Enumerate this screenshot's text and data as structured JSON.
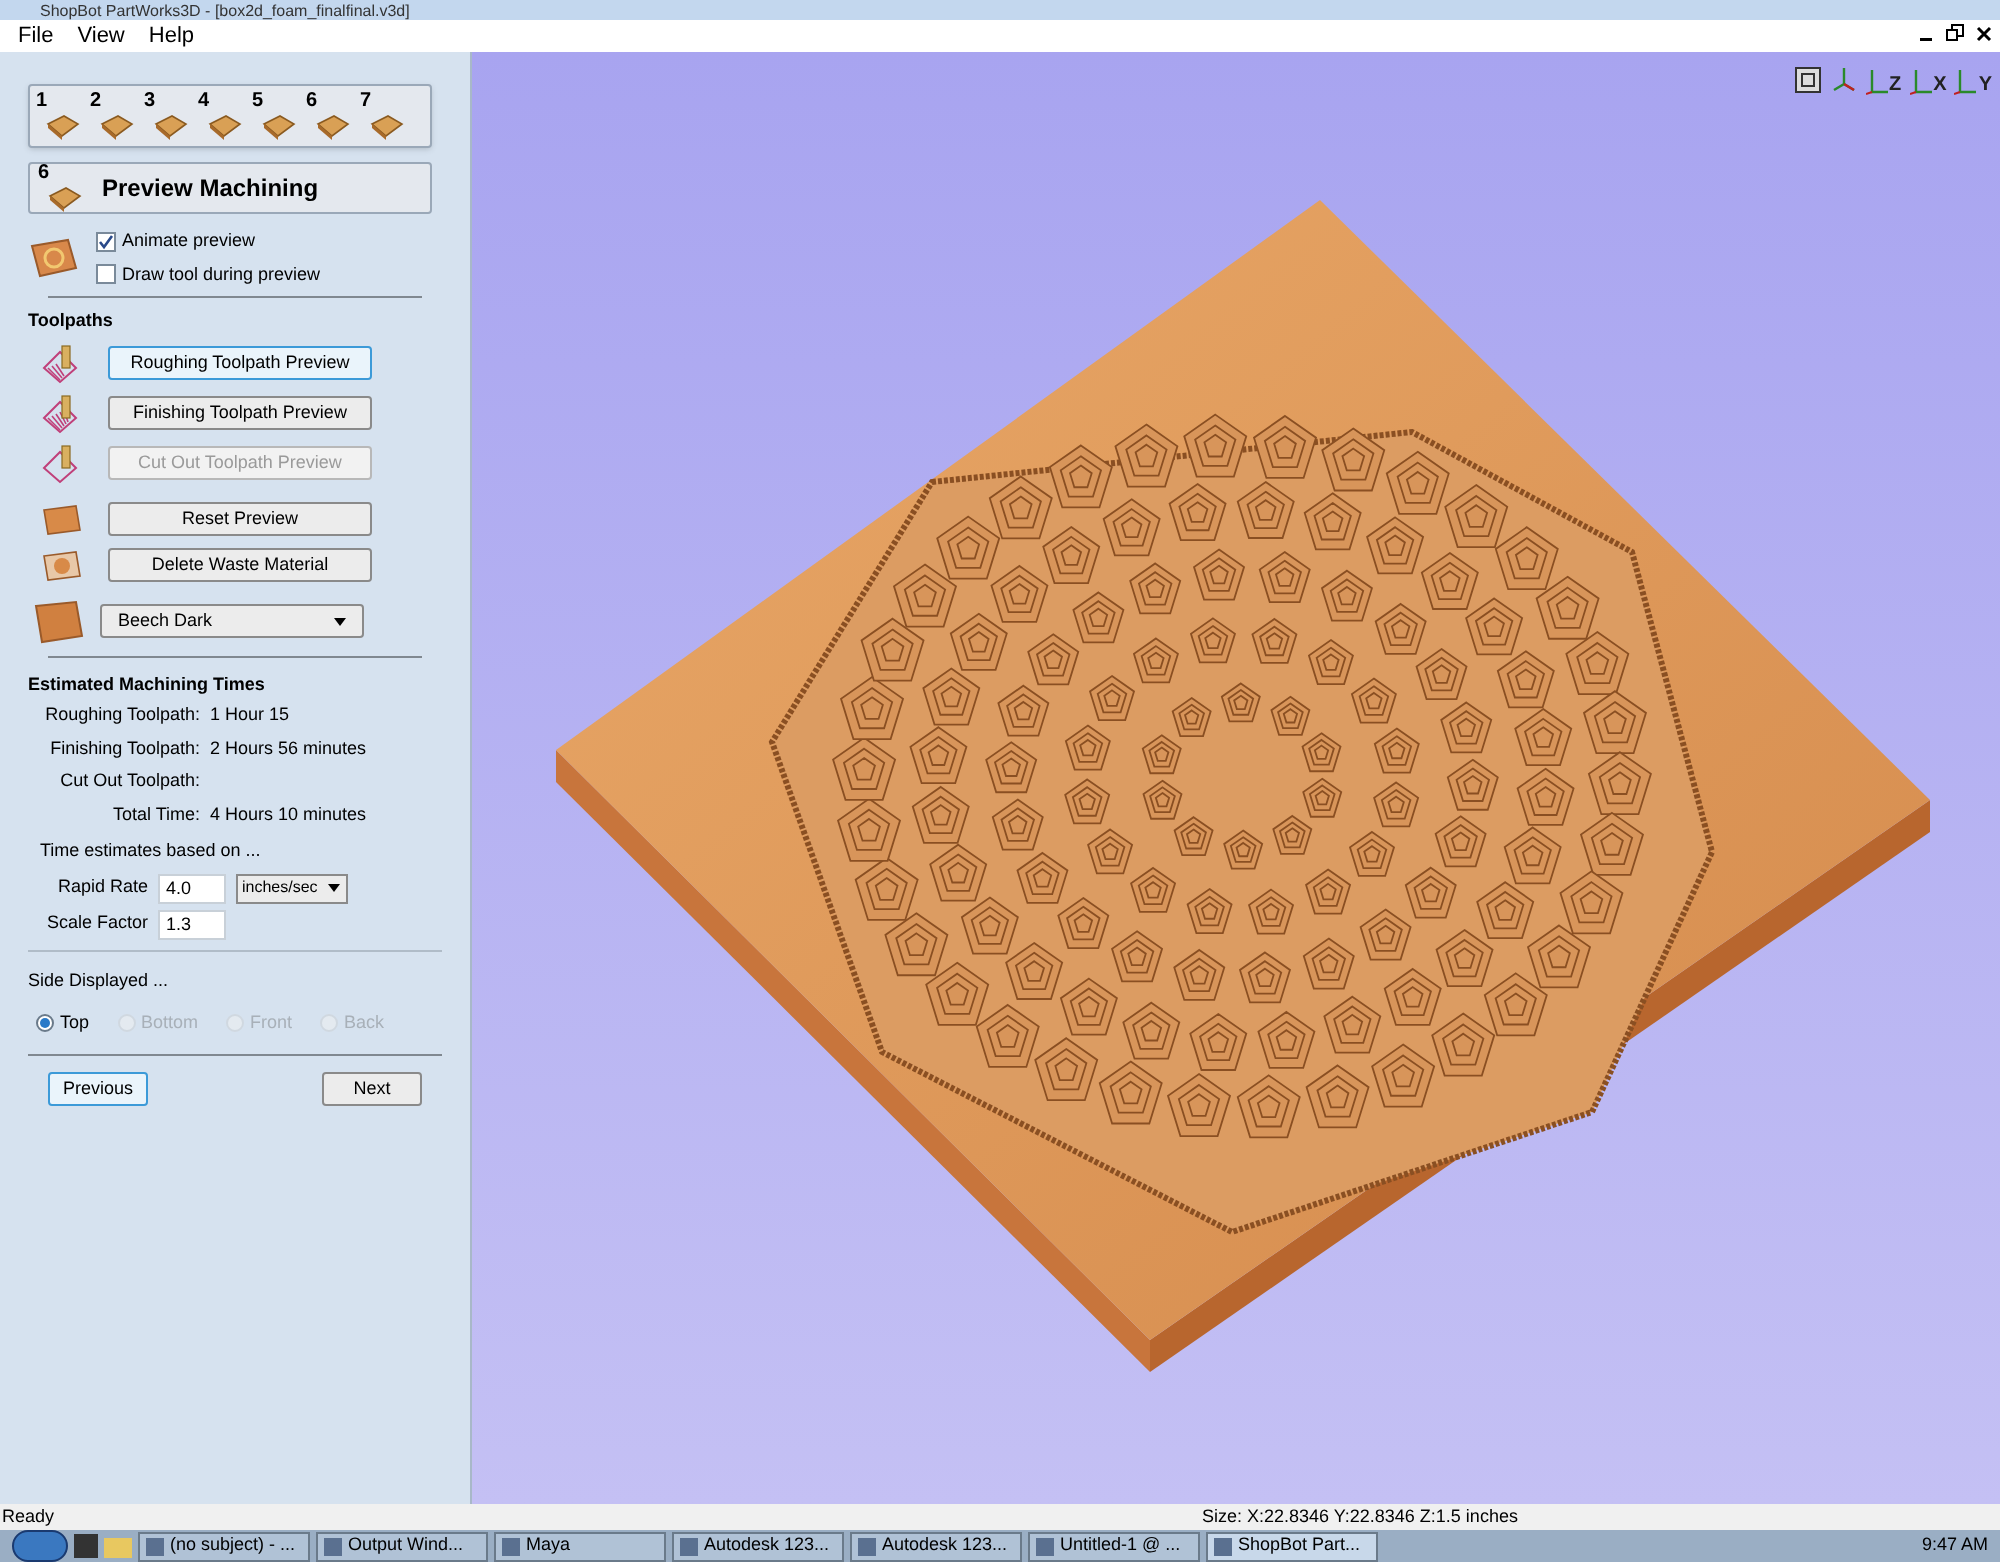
{
  "window": {
    "title": "ShopBot PartWorks3D - [box2d_foam_finalfinal.v3d]"
  },
  "menu": [
    "File",
    "View",
    "Help"
  ],
  "steps": [
    "1",
    "2",
    "3",
    "4",
    "5",
    "6",
    "7"
  ],
  "page": {
    "number": "6",
    "title": "Preview Machining"
  },
  "options": [
    {
      "label": "Animate preview",
      "checked": true
    },
    {
      "label": "Draw tool during preview",
      "checked": false
    }
  ],
  "toolpaths": {
    "heading": "Toolpaths",
    "buttons": [
      {
        "label": "Roughing Toolpath Preview",
        "kind": "roughing",
        "focused": true,
        "disabled": false
      },
      {
        "label": "Finishing Toolpath Preview",
        "kind": "finishing",
        "focused": false,
        "disabled": false
      },
      {
        "label": "Cut Out Toolpath Preview",
        "kind": "cutout",
        "focused": false,
        "disabled": true
      }
    ]
  },
  "actions": [
    {
      "label": "Reset Preview",
      "kind": "block"
    },
    {
      "label": "Delete Waste Material",
      "kind": "waste"
    }
  ],
  "material": {
    "value": "Beech Dark"
  },
  "times": {
    "heading": "Estimated Machining Times",
    "rows": [
      {
        "label": "Roughing Toolpath:",
        "value": "1 Hour 15"
      },
      {
        "label": "Finishing Toolpath:",
        "value": "2 Hours 56 minutes"
      },
      {
        "label": "Cut Out Toolpath:",
        "value": ""
      },
      {
        "label": "Total Time:",
        "value": "4 Hours 10 minutes"
      }
    ],
    "note": "Time estimates based on ...",
    "rapid_rate": {
      "label": "Rapid Rate",
      "value": "4.0",
      "unit": "inches/sec"
    },
    "scale_factor": {
      "label": "Scale Factor",
      "value": "1.3"
    }
  },
  "side": {
    "heading": "Side Displayed ...",
    "options": [
      {
        "label": "Top",
        "selected": true,
        "disabled": false
      },
      {
        "label": "Bottom",
        "selected": false,
        "disabled": true
      },
      {
        "label": "Front",
        "selected": false,
        "disabled": true
      },
      {
        "label": "Back",
        "selected": false,
        "disabled": true
      }
    ]
  },
  "nav": [
    {
      "label": "Previous",
      "focused": true
    },
    {
      "label": "Next",
      "focused": false
    }
  ],
  "view_icons": [
    "Z",
    "X",
    "Y"
  ],
  "status_bar": {
    "left": "Ready",
    "right": "Size: X:22.8346 Y:22.8346 Z:1.5 inches"
  },
  "taskbar": {
    "tasks": [
      {
        "label": "(no subject) - ...",
        "selected": false
      },
      {
        "label": "Output Wind...",
        "selected": false
      },
      {
        "label": "Maya",
        "selected": false
      },
      {
        "label": "Autodesk 123...",
        "selected": false
      },
      {
        "label": "Autodesk 123...",
        "selected": false
      },
      {
        "label": "Untitled-1 @ ...",
        "selected": false
      },
      {
        "label": "ShopBot Part...",
        "selected": true
      }
    ],
    "clock": "9:47 AM"
  }
}
